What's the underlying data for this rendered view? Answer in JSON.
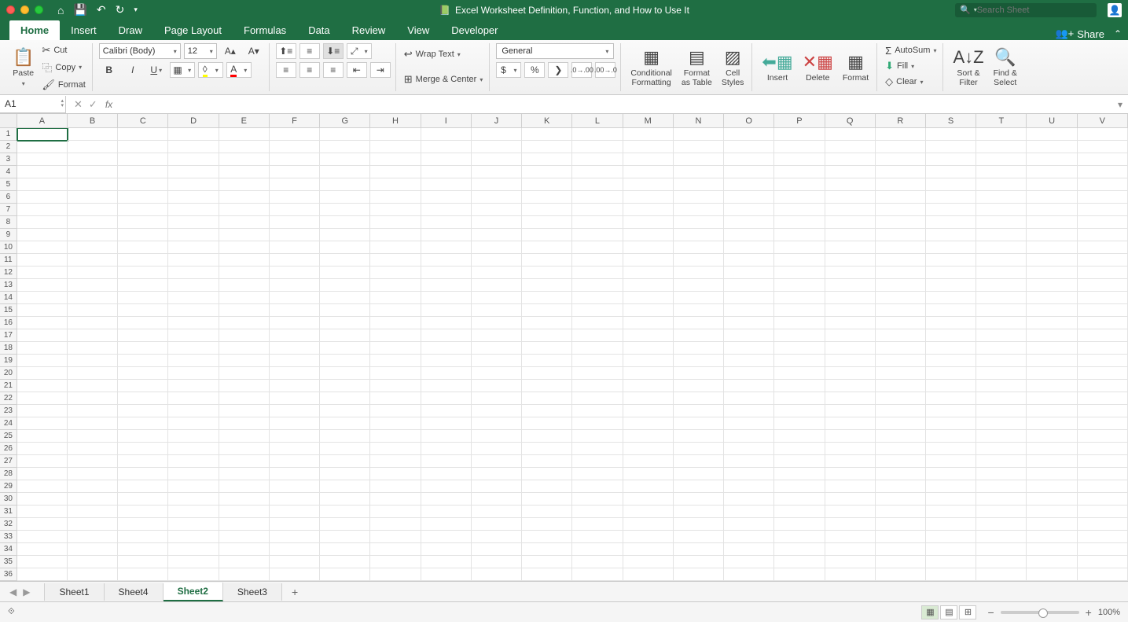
{
  "title": "Excel Worksheet Definition, Function, and How to Use It",
  "search_placeholder": "Search Sheet",
  "tabs": [
    "Home",
    "Insert",
    "Draw",
    "Page Layout",
    "Formulas",
    "Data",
    "Review",
    "View",
    "Developer"
  ],
  "active_tab": 0,
  "share_label": "Share",
  "clipboard": {
    "paste": "Paste",
    "cut": "Cut",
    "copy": "Copy",
    "format": "Format"
  },
  "font": {
    "name": "Calibri (Body)",
    "size": "12"
  },
  "alignment": {
    "wrap": "Wrap Text",
    "merge": "Merge & Center"
  },
  "number": {
    "format": "General"
  },
  "styles": {
    "cond": "Conditional\nFormatting",
    "table": "Format\nas Table",
    "cell": "Cell\nStyles"
  },
  "cells": {
    "insert": "Insert",
    "delete": "Delete",
    "format": "Format"
  },
  "editing": {
    "autosum": "AutoSum",
    "fill": "Fill",
    "clear": "Clear",
    "sort": "Sort &\nFilter",
    "find": "Find &\nSelect"
  },
  "namebox": "A1",
  "columns": [
    "A",
    "B",
    "C",
    "D",
    "E",
    "F",
    "G",
    "H",
    "I",
    "J",
    "K",
    "L",
    "M",
    "N",
    "O",
    "P",
    "Q",
    "R",
    "S",
    "T",
    "U",
    "V"
  ],
  "row_count": 36,
  "selected_cell": {
    "row": 1,
    "col": 0
  },
  "sheets": [
    "Sheet1",
    "Sheet4",
    "Sheet2",
    "Sheet3"
  ],
  "active_sheet": 2,
  "zoom": "100%"
}
